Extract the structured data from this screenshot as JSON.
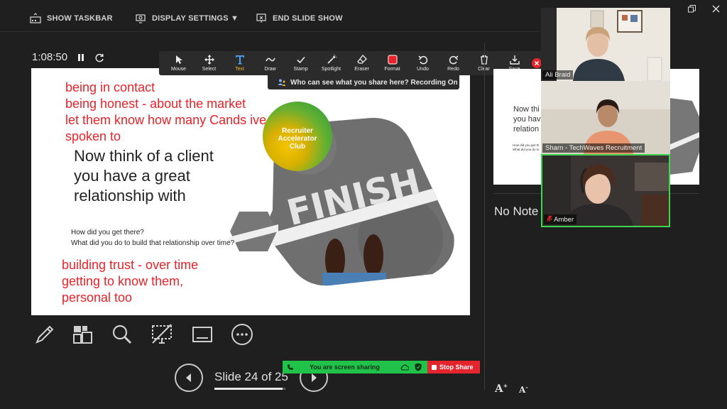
{
  "topbar": {
    "show_taskbar": "SHOW TASKBAR",
    "display_settings": "DISPLAY SETTINGS ▼",
    "end_slide_show": "END SLIDE SHOW"
  },
  "timer": {
    "elapsed": "1:08:50"
  },
  "annotation_toolbar": {
    "tools": [
      "Mouse",
      "Select",
      "Text",
      "Draw",
      "Stamp",
      "Spotlight",
      "Eraser",
      "Format",
      "Undo",
      "Redo",
      "Clear",
      "Save"
    ],
    "active_tool": "Text",
    "format_color": "#e8232a"
  },
  "recording_banner": {
    "text": "Who can see what you share here? Recording On"
  },
  "slide": {
    "annotations_top": [
      "being in contact",
      "being honest - about the market",
      "let them know how many Cands ive",
      "spoken to"
    ],
    "main_text": [
      "Now think of a client",
      "you have a great",
      "relationship with"
    ],
    "questions": [
      "How did you get there?",
      "What did you do to build that relationship over time?"
    ],
    "annotations_bottom": [
      "building trust  - over time",
      "getting to know them,",
      "personal too"
    ],
    "logo_lines": [
      "Recruiter",
      "Accelerator",
      "Club"
    ],
    "finish_word": "FINISH"
  },
  "navigation": {
    "counter": "Slide 24 of 25",
    "current": 24,
    "total": 25
  },
  "sharing": {
    "status": "You are screen sharing",
    "stop_label": "Stop Share",
    "status_color": "#21c24a",
    "stop_color": "#e5252d"
  },
  "next_slide": {
    "main_text": [
      "Now thi",
      "you hav",
      "relation"
    ],
    "questions": [
      "How did you get th",
      "What did you do to"
    ]
  },
  "notes": {
    "placeholder": "No Note"
  },
  "participants": [
    {
      "name": "Ali Braid"
    },
    {
      "name": "Sharn - TechWaves Recruitment"
    },
    {
      "name": "Amber",
      "muted": true
    }
  ]
}
